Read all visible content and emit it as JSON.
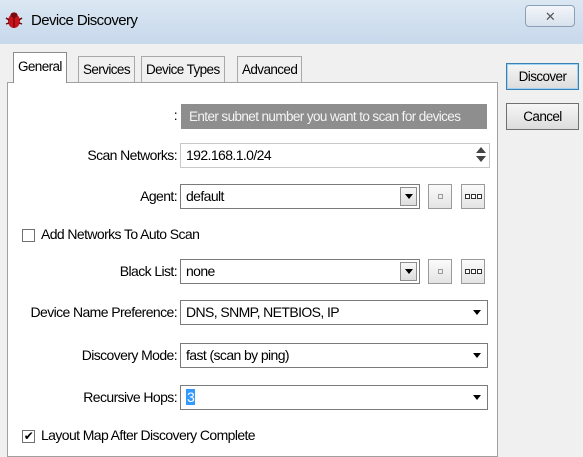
{
  "window": {
    "title": "Device Discovery",
    "close_symbol": "✕"
  },
  "tabs": [
    {
      "label": "General",
      "active": true
    },
    {
      "label": "Services",
      "active": false
    },
    {
      "label": "Device Types",
      "active": false
    },
    {
      "label": "Advanced",
      "active": false
    }
  ],
  "side_buttons": {
    "discover": "Discover",
    "cancel": "Cancel"
  },
  "form": {
    "hint_colon": ":",
    "hint_text": "Enter subnet number you want to scan for devices",
    "scan_networks": {
      "label": "Scan Networks:",
      "value": "192.168.1.0/24"
    },
    "agent": {
      "label": "Agent:",
      "value": "default"
    },
    "add_networks": {
      "label": "Add Networks To Auto Scan",
      "checked": false
    },
    "black_list": {
      "label": "Black List:",
      "value": "none"
    },
    "device_name_preference": {
      "label": "Device Name Preference:",
      "value": "DNS, SNMP, NETBIOS, IP"
    },
    "discovery_mode": {
      "label": "Discovery Mode:",
      "value": "fast (scan by ping)"
    },
    "recursive_hops": {
      "label": "Recursive Hops:",
      "value": "3"
    },
    "layout_map": {
      "label": "Layout Map After Discovery Complete",
      "checked": true
    }
  },
  "colors": {
    "titlebar": "#cfdeee",
    "hint_bg": "#8e8e8e",
    "selection": "#3399ff"
  }
}
